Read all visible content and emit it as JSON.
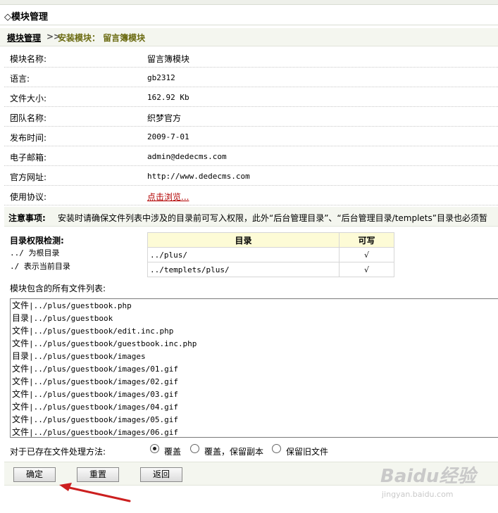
{
  "title": "◇模块管理",
  "breadcrumb": {
    "root": "模块管理",
    "separator": ">>",
    "current": "安装模块： 留言簿模块"
  },
  "info": [
    {
      "label": "模块名称:",
      "value": "留言簿模块"
    },
    {
      "label": "语言:",
      "value": "gb2312"
    },
    {
      "label": "文件大小:",
      "value": "162.92 Kb"
    },
    {
      "label": "团队名称:",
      "value": "织梦官方"
    },
    {
      "label": "发布时间:",
      "value": "2009-7-01"
    },
    {
      "label": "电子邮箱:",
      "value": "admin@dedecms.com"
    },
    {
      "label": "官方网址:",
      "value": "http://www.dedecms.com"
    },
    {
      "label": "使用协议:",
      "value": "点击浏览..."
    }
  ],
  "notice": {
    "label": "注意事项:",
    "text": "安装时请确保文件列表中涉及的目录前可写入权限，此外“后台管理目录”、“后台管理目录/templets”目录也必须暂"
  },
  "permissions": {
    "title": "目录权限检测:",
    "lines": [
      "../ 为根目录",
      "./ 表示当前目录"
    ],
    "headers": [
      "目录",
      "可写"
    ],
    "rows": [
      {
        "dir": "../plus/",
        "writable": "√"
      },
      {
        "dir": "../templets/plus/",
        "writable": "√"
      }
    ]
  },
  "files": {
    "label": "模块包含的所有文件列表:",
    "items": [
      {
        "type": "文件",
        "path": "|../plus/guestbook.php"
      },
      {
        "type": "目录",
        "path": "|../plus/guestbook"
      },
      {
        "type": "文件",
        "path": "|../plus/guestbook/edit.inc.php"
      },
      {
        "type": "文件",
        "path": "|../plus/guestbook/guestbook.inc.php"
      },
      {
        "type": "目录",
        "path": "|../plus/guestbook/images"
      },
      {
        "type": "文件",
        "path": "|../plus/guestbook/images/01.gif"
      },
      {
        "type": "文件",
        "path": "|../plus/guestbook/images/02.gif"
      },
      {
        "type": "文件",
        "path": "|../plus/guestbook/images/03.gif"
      },
      {
        "type": "文件",
        "path": "|../plus/guestbook/images/04.gif"
      },
      {
        "type": "文件",
        "path": "|../plus/guestbook/images/05.gif"
      },
      {
        "type": "文件",
        "path": "|../plus/guestbook/images/06.gif"
      }
    ]
  },
  "method": {
    "label": "对于已存在文件处理方法:",
    "options": [
      "覆盖",
      "覆盖，保留副本",
      "保留旧文件"
    ],
    "selected": "覆盖"
  },
  "buttons": {
    "ok": "确定",
    "reset": "重置",
    "back": "返回"
  },
  "colors": {
    "arrow": "#cc1f1f",
    "link": "#b20000",
    "bar_bg": "#f4f6ef"
  },
  "watermark": {
    "brand": "Baidu经验",
    "url": "jingyan.baidu.com"
  }
}
